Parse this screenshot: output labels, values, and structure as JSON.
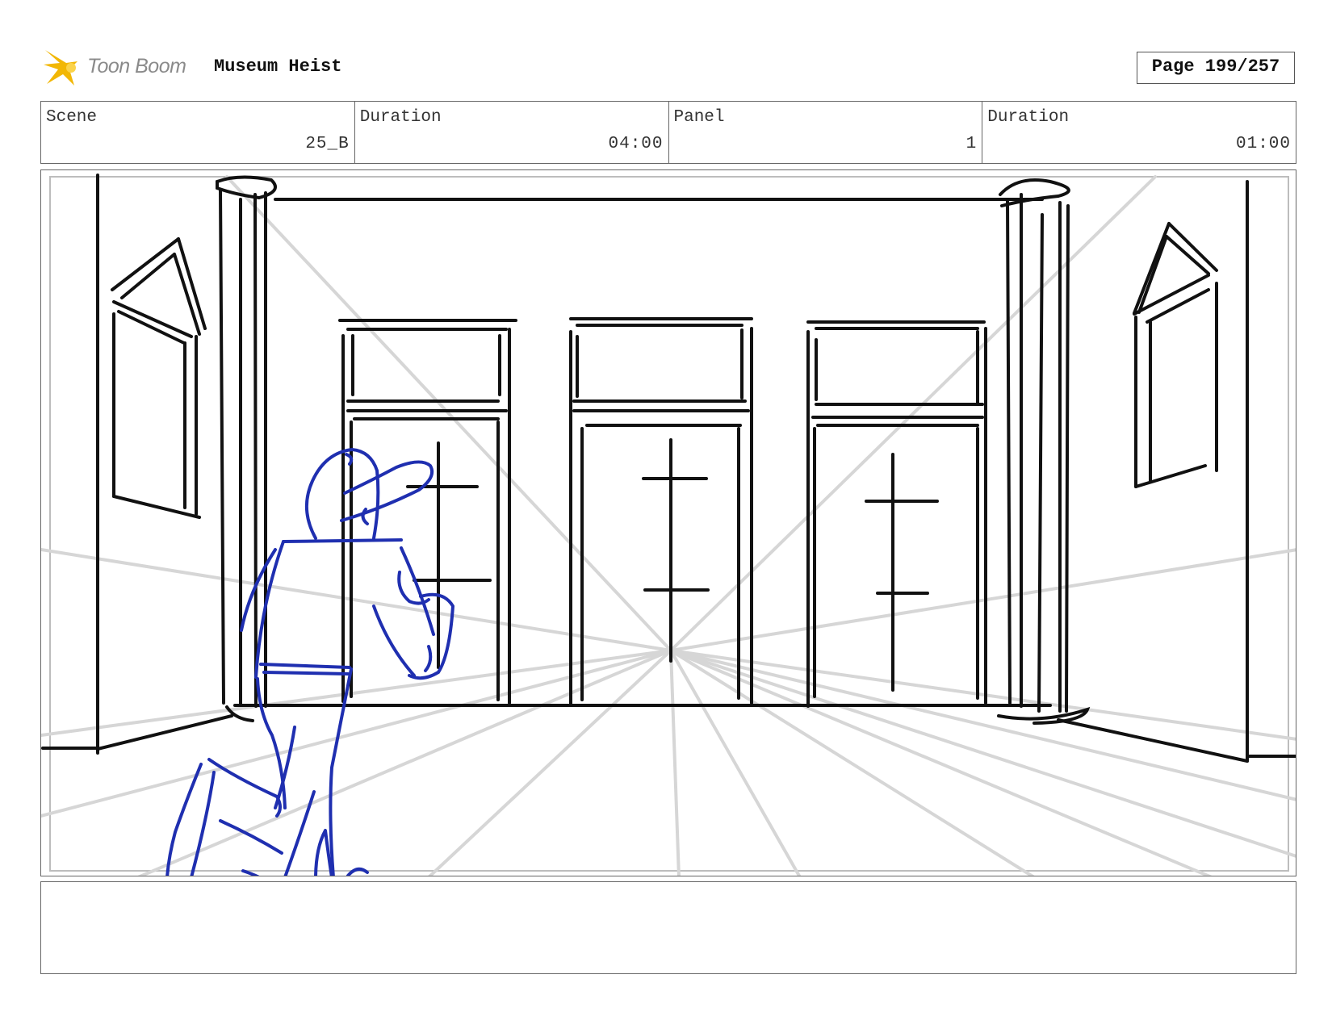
{
  "header": {
    "logo_text": "Toon Boom",
    "project_title": "Museum Heist",
    "page_label": "Page 199/257"
  },
  "info": {
    "scene_label": "Scene",
    "scene_value": "25_B",
    "scene_duration_label": "Duration",
    "scene_duration_value": "04:00",
    "panel_label": "Panel",
    "panel_value": "1",
    "panel_duration_label": "Duration",
    "panel_duration_value": "01:00"
  },
  "colors": {
    "logo_star": "#f2b705",
    "sketch_black": "#111111",
    "sketch_blue": "#1f2fb0",
    "guide_gray": "#d6d6d6"
  },
  "icons": {
    "logo": "toon-boom-star-icon"
  },
  "notes": {
    "text": ""
  }
}
